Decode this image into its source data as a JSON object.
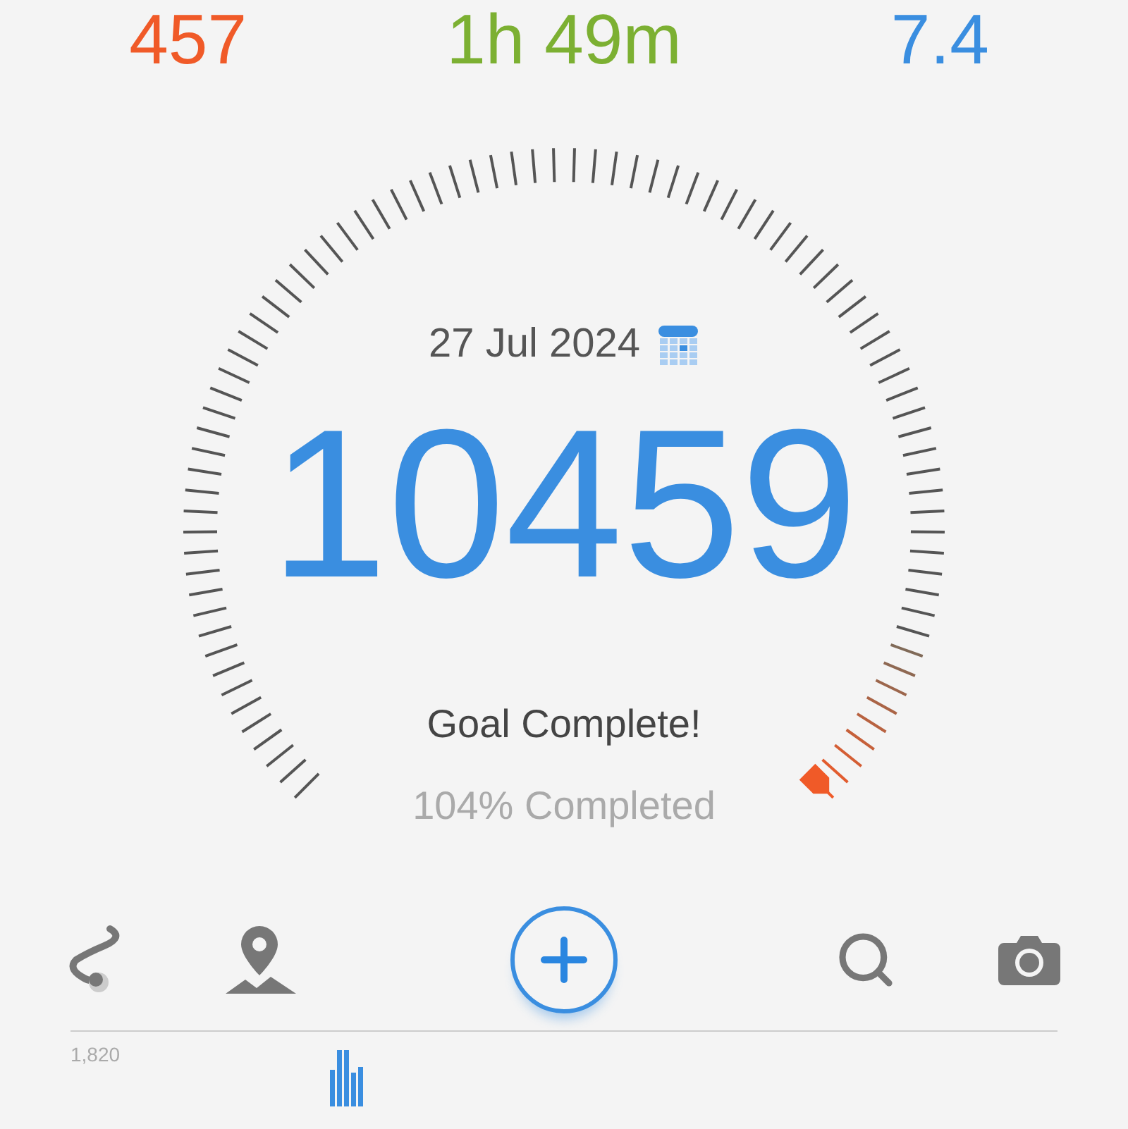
{
  "stats": [
    {
      "value": "457",
      "color": "#f05a28"
    },
    {
      "value": "1h 49m",
      "color": "#7cb032"
    },
    {
      "value": "7.4",
      "color": "#3a8ee0"
    }
  ],
  "gauge": {
    "date": "27 Jul 2024",
    "steps": "10459",
    "status": "Goal Complete!",
    "percent": "104% Completed"
  },
  "chart": {
    "axis_label": "1,820"
  }
}
